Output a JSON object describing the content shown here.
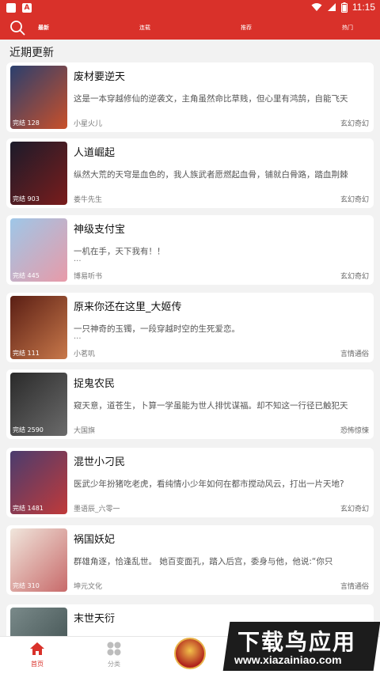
{
  "status_bar": {
    "time": "11:15",
    "app_badge": "A"
  },
  "top_nav": {
    "tabs": [
      {
        "label": "最新",
        "active": true
      },
      {
        "label": "连载",
        "active": false
      },
      {
        "label": "推荐",
        "active": false
      },
      {
        "label": "热门",
        "active": false
      }
    ]
  },
  "section_title": "近期更新",
  "books": [
    {
      "title": "废材要逆天",
      "desc": "这是一本穿越修仙的逆袭文，主角虽然命比草贱，但心里有鸿鹄，自能飞天",
      "ellipsis": "",
      "author": "小星火儿",
      "genre": "玄幻奇幻",
      "badge": "完结 128",
      "colors": [
        "#2a3f6e",
        "#c9502a"
      ]
    },
    {
      "title": "人道崛起",
      "desc": "纵然大荒的天穹是血色的，我人族武者愿燃起血骨，铺就白骨路，踏血荆棘",
      "ellipsis": "",
      "author": "娄牛先生",
      "genre": "玄幻奇幻",
      "badge": "完结 903",
      "colors": [
        "#1b1b2a",
        "#7a1c1c"
      ]
    },
    {
      "title": "神级支付宝",
      "desc": "一机在手，天下我有！！",
      "ellipsis": "...",
      "author": "博易听书",
      "genre": "玄幻奇幻",
      "badge": "完结 445",
      "colors": [
        "#9ec7e8",
        "#e89aa8"
      ]
    },
    {
      "title": "原来你还在这里_大姬传",
      "desc": " 一只神奇的玉镯，一段穿越时空的生死爱恋。",
      "ellipsis": "...",
      "author": "小茗叽",
      "genre": "言情通俗",
      "badge": "完结 111",
      "colors": [
        "#5a1e14",
        "#c8784a"
      ]
    },
    {
      "title": "捉鬼农民",
      "desc": "窥天意，道苍生，卜算一学虽能为世人排忧谋福。却不知这一行径已触犯天",
      "ellipsis": "",
      "author": "大国旗",
      "genre": "恐怖惊悚",
      "badge": "完结 2590",
      "colors": [
        "#2a2a2a",
        "#6b6b6b"
      ]
    },
    {
      "title": "混世小刁民",
      "desc": "医武少年扮猪吃老虎，看纯情小少年如何在都市搅动风云，打出一片天地?",
      "ellipsis": "",
      "author": "墨语辰_六零一",
      "genre": "玄幻奇幻",
      "badge": "完结 1481",
      "colors": [
        "#4a3c6e",
        "#c03a3a"
      ]
    },
    {
      "title": "祸国妖妃",
      "desc": "群雄角逐，恰逢乱世。 她百变面孔，踏入后宫，委身与他，他说:“你只",
      "ellipsis": "",
      "author": "坤元文化",
      "genre": "言情通俗",
      "badge": "完结 310",
      "colors": [
        "#f0e6dc",
        "#c86a6a"
      ]
    },
    {
      "title": "末世天衍",
      "desc": "",
      "ellipsis": "",
      "author": "",
      "genre": "",
      "badge": "",
      "colors": [
        "#7a8a8a",
        "#3a4a4a"
      ]
    }
  ],
  "bottom_nav": {
    "items": [
      {
        "label": "首页",
        "active": true
      },
      {
        "label": "分类",
        "active": false
      }
    ]
  },
  "watermark": {
    "line1": "下载鸟应用",
    "line2": "www.xiazainiao.com"
  },
  "colors": {
    "brand_red": "#d9312a"
  }
}
